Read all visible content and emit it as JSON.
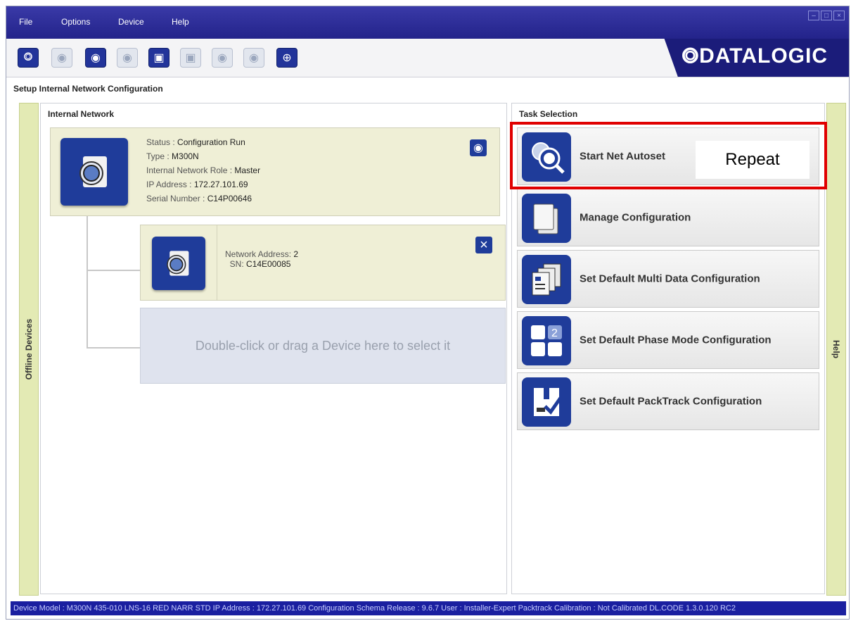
{
  "menu": {
    "file": "File",
    "options": "Options",
    "device": "Device",
    "help": "Help"
  },
  "brand": {
    "logo": "⭗DATALOGIC",
    "accent": "#23238a"
  },
  "page": {
    "title": "Setup Internal Network Configuration"
  },
  "sidebar": {
    "left": "Offline Devices",
    "right": "Help"
  },
  "network": {
    "title": "Internal Network",
    "master": {
      "status_label": "Status :",
      "status": "Configuration Run",
      "type_label": "Type :",
      "type": "M300N",
      "role_label": "Internal Network Role :",
      "role": "Master",
      "ip_label": "IP Address :",
      "ip": "172.27.101.69",
      "serial_label": "Serial Number :",
      "serial": "C14P00646"
    },
    "slave": {
      "address_label": "Network Address:",
      "address": "2",
      "sn_label": "SN:",
      "sn": "C14E00085"
    },
    "drop_zone": "Double-click or drag a Device here to select it"
  },
  "tasks": {
    "title": "Task Selection",
    "items": [
      {
        "label": "Start Net Autoset",
        "icon": "net-autoset-icon"
      },
      {
        "label": "Manage Configuration",
        "icon": "documents-icon"
      },
      {
        "label": "Set Default Multi Data Configuration",
        "icon": "multi-data-icon"
      },
      {
        "label": "Set Default Phase Mode Configuration",
        "icon": "phase-mode-icon"
      },
      {
        "label": "Set Default PackTrack Configuration",
        "icon": "packtrack-icon"
      }
    ],
    "annotation": "Repeat"
  },
  "statusbar": {
    "text": "Device Model : M300N 435-010 LNS-16 RED NARR STD   IP Address :  172.27.101.69   Configuration Schema Release :  9.6.7   User : Installer-Expert   Packtrack Calibration : Not Calibrated   DL.CODE 1.3.0.120 RC2"
  }
}
